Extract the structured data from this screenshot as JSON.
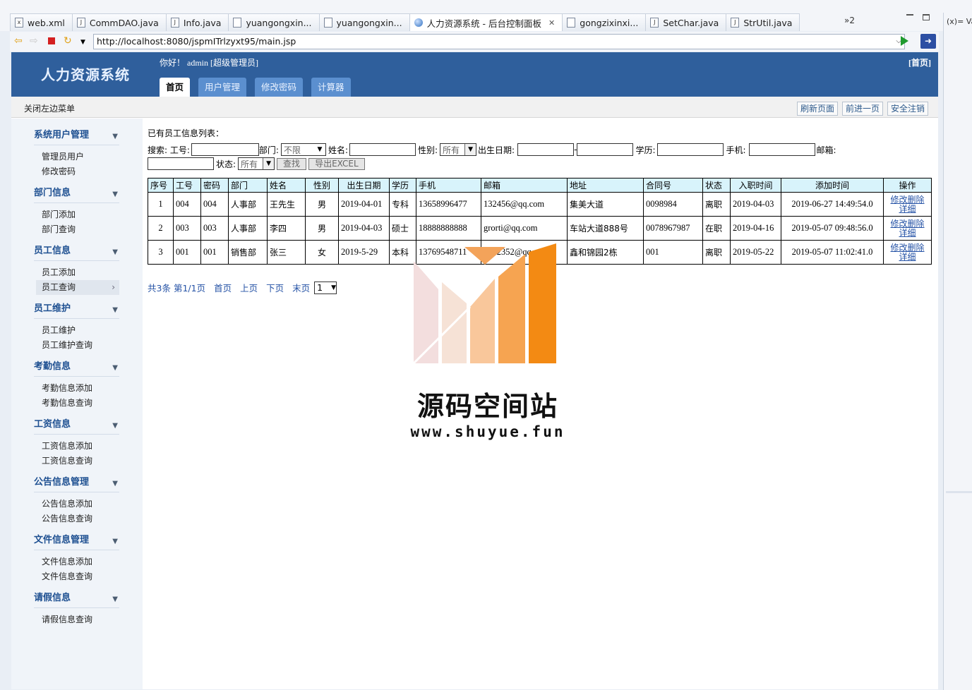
{
  "ide": {
    "tabs": [
      {
        "label": "web.xml",
        "icon": "xml-file-icon"
      },
      {
        "label": "CommDAO.java",
        "icon": "java-file-icon"
      },
      {
        "label": "Info.java",
        "icon": "java-file-icon"
      },
      {
        "label": "yuangongxin...",
        "icon": "jsp-file-icon"
      },
      {
        "label": "yuangongxin...",
        "icon": "jsp-file-icon"
      },
      {
        "label": "人力资源系统 - 后台控制面板",
        "icon": "globe-icon",
        "active": true
      },
      {
        "label": "gongzixinxi...",
        "icon": "jsp-file-icon"
      },
      {
        "label": "SetChar.java",
        "icon": "java-file-icon"
      },
      {
        "label": "StrUtil.java",
        "icon": "java-file-icon"
      }
    ],
    "overflow_label": "»2",
    "side_view_label": "(x)= Var"
  },
  "browser": {
    "url": "http://localhost:8080/jspmITrlzyxt95/main.jsp"
  },
  "app": {
    "title": "人力资源系统",
    "greeting": "你好！ admin [超级管理员]",
    "home_link": "[首页]",
    "tabs": [
      "首页",
      "用户管理",
      "修改密码",
      "计算器"
    ],
    "close_menu": "关闭左边菜单",
    "actions": [
      "刷新页面",
      "前进一页",
      "安全注销"
    ]
  },
  "sidebar": [
    {
      "title": "系统用户管理",
      "items": [
        "管理员用户",
        "修改密码"
      ]
    },
    {
      "title": "部门信息",
      "items": [
        "部门添加",
        "部门查询"
      ]
    },
    {
      "title": "员工信息",
      "items": [
        "员工添加",
        "员工查询"
      ],
      "active_item": 1
    },
    {
      "title": "员工维护",
      "items": [
        "员工维护",
        "员工维护查询"
      ]
    },
    {
      "title": "考勤信息",
      "items": [
        "考勤信息添加",
        "考勤信息查询"
      ]
    },
    {
      "title": "工资信息",
      "items": [
        "工资信息添加",
        "工资信息查询"
      ]
    },
    {
      "title": "公告信息管理",
      "items": [
        "公告信息添加",
        "公告信息查询"
      ]
    },
    {
      "title": "文件信息管理",
      "items": [
        "文件信息添加",
        "文件信息查询"
      ]
    },
    {
      "title": "请假信息",
      "items": [
        "请假信息查询"
      ]
    }
  ],
  "main": {
    "list_title": "已有员工信息列表：",
    "search": {
      "label_search": "搜索: 工号:",
      "label_dept": "部门:",
      "dept_value": "不限",
      "label_name": "姓名:",
      "label_gender": "性别:",
      "gender_value": "所有",
      "label_birth": "出生日期:",
      "birth_sep": "-",
      "label_edu": "学历:",
      "label_phone": "手机:",
      "label_email": "邮箱:",
      "label_status": "状态:",
      "status_value": "所有",
      "btn_find": "查找",
      "btn_excel": "导出EXCEL"
    },
    "table": {
      "headers": [
        "序号",
        "工号",
        "密码",
        "部门",
        "姓名",
        "性别",
        "出生日期",
        "学历",
        "手机",
        "邮箱",
        "地址",
        "合同号",
        "状态",
        "入职时间",
        "添加时间",
        "操作"
      ],
      "rows": [
        [
          "1",
          "004",
          "004",
          "人事部",
          "王先生",
          "男",
          "2019-04-01",
          "专科",
          "13658996477",
          "132456@qq.com",
          "集美大道",
          "0098984",
          "离职",
          "2019-04-03",
          "2019-06-27 14:49:54.0"
        ],
        [
          "2",
          "003",
          "003",
          "人事部",
          "李四",
          "男",
          "2019-04-03",
          "硕士",
          "18888888888",
          "grorti@qq.com",
          "车站大道888号",
          "0078967987",
          "在职",
          "2019-04-16",
          "2019-05-07 09:48:56.0"
        ],
        [
          "3",
          "001",
          "001",
          "销售部",
          "张三",
          "女",
          "2019-5-29",
          "本科",
          "13769548711",
          "1552352@qq.com",
          "鑫和锦园2栋",
          "001",
          "离职",
          "2019-05-22",
          "2019-05-07 11:02:41.0"
        ]
      ],
      "op_edit": "修改",
      "op_delete": "删除",
      "op_detail": "详细"
    },
    "pager": {
      "total": "共3条",
      "page": "第1/1页",
      "first": "首页",
      "prev": "上页",
      "next": "下页",
      "last": "末页",
      "select_value": "1"
    }
  },
  "watermark": {
    "text": "源码空间站",
    "url": "www.shuyue.fun"
  }
}
